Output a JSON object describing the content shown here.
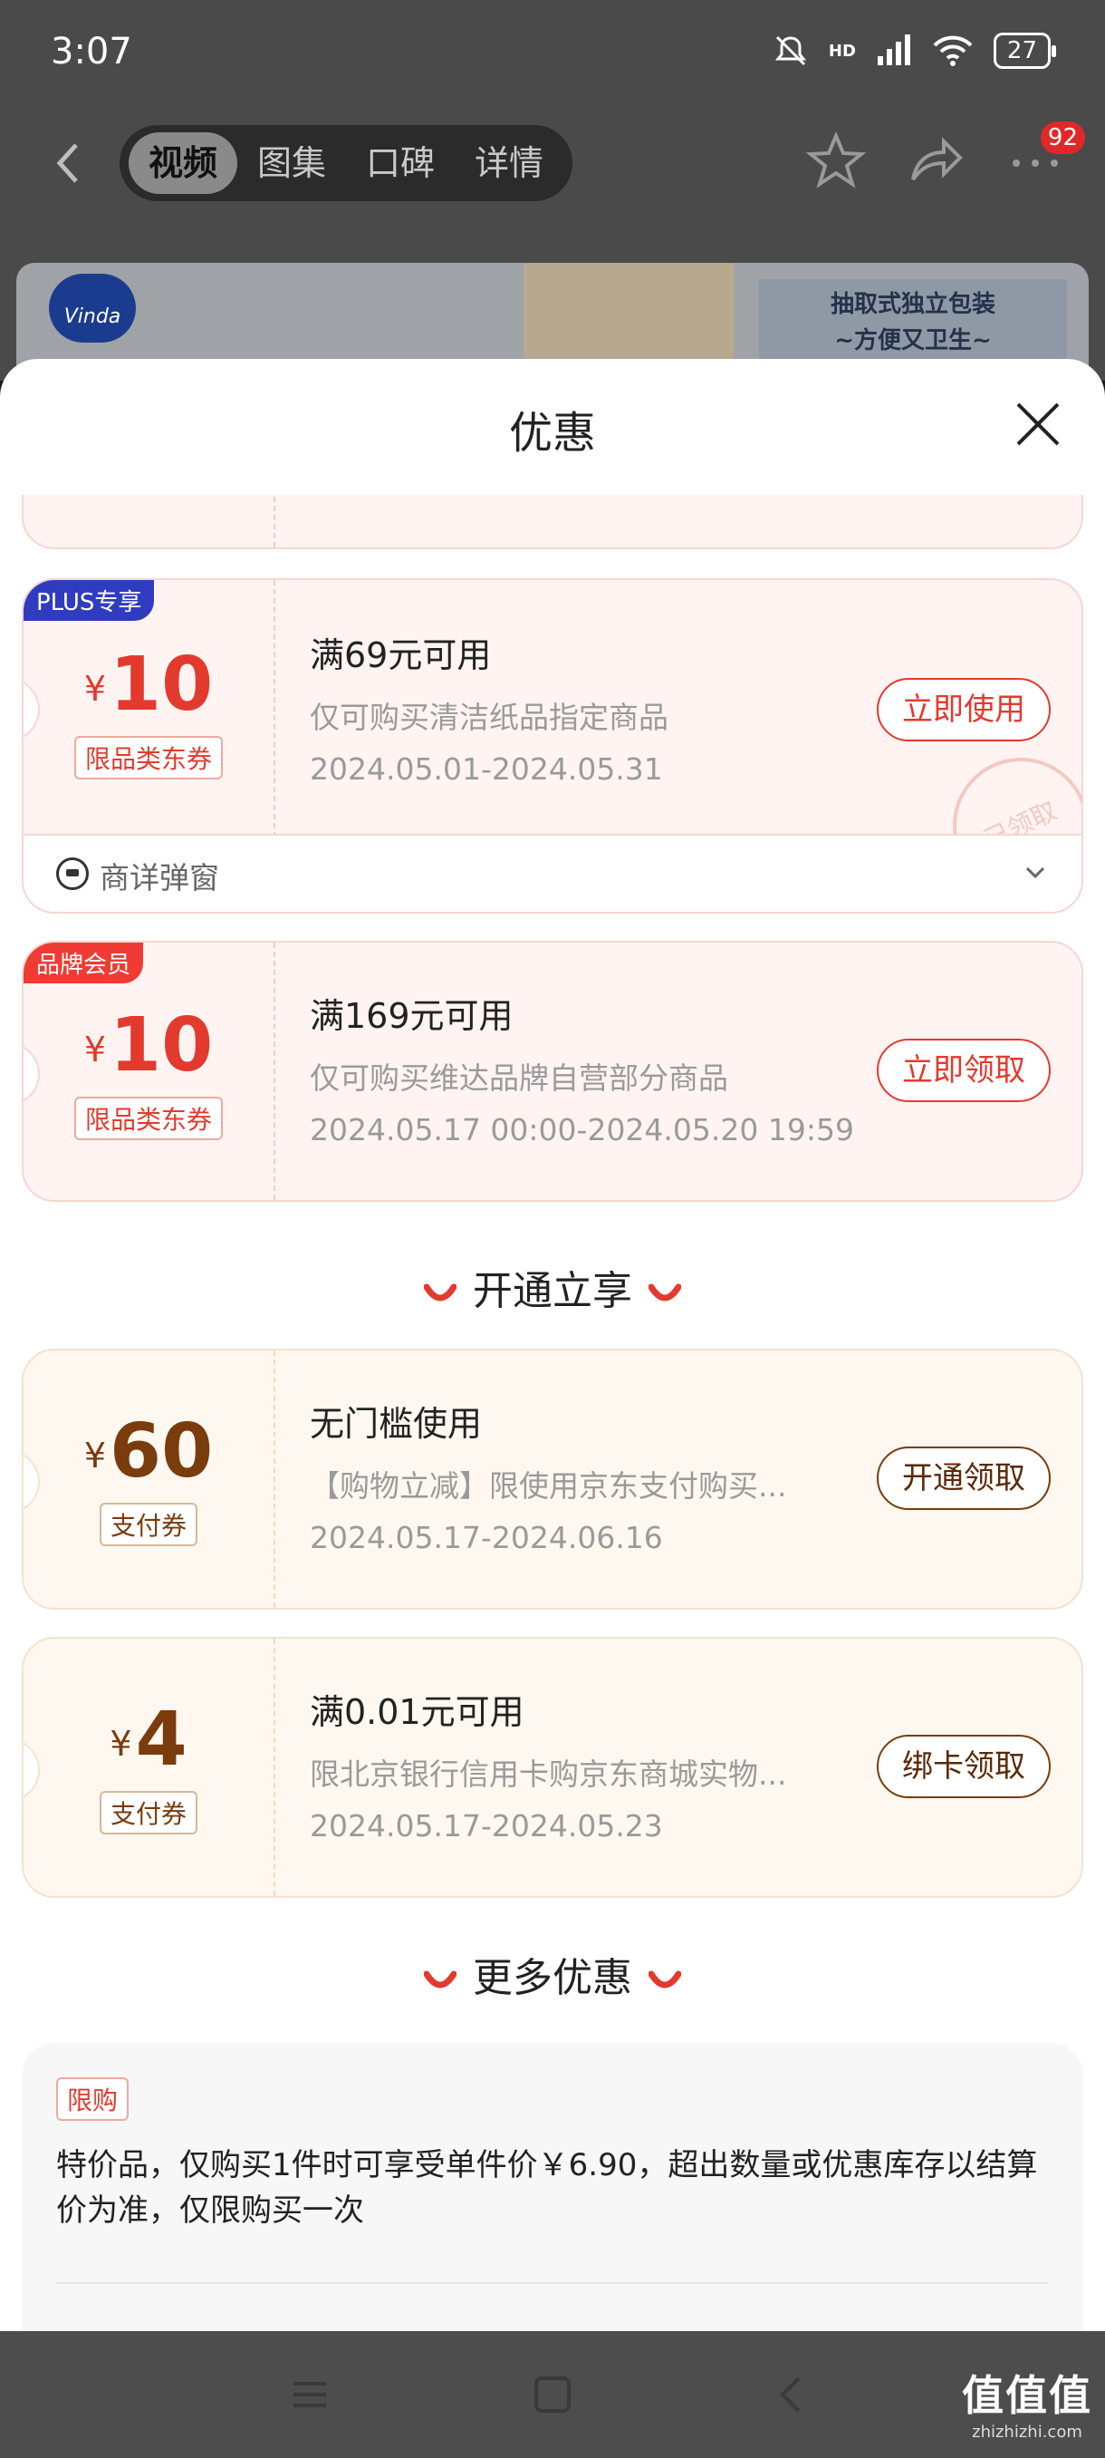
{
  "status_bar": {
    "time": "3:07",
    "network": "HD",
    "battery": "27"
  },
  "top_nav": {
    "tabs": [
      "视频",
      "图集",
      "口碑",
      "详情"
    ],
    "active_tab": 0,
    "badge_count": "92"
  },
  "banner": {
    "logo_text": "Vinda",
    "tagline_line1": "抽取式独立包装",
    "tagline_line2": "~方便又卫生~"
  },
  "sheet": {
    "title": "优惠"
  },
  "coupons": [
    {
      "tag": "PLUS专享",
      "amount_symbol": "¥",
      "amount": "10",
      "type": "限品类东券",
      "condition": "满69元可用",
      "description": "仅可购买清洁纸品指定商品",
      "date": "2024.05.01-2024.05.31",
      "button": "立即使用",
      "stamp": "已领取",
      "detail_label": "商详弹窗"
    },
    {
      "tag": "品牌会员",
      "amount_symbol": "¥",
      "amount": "10",
      "type": "限品类东券",
      "condition": "满169元可用",
      "description": "仅可购买维达品牌自营部分商品",
      "date": "2024.05.17 00:00-2024.05.20 19:59",
      "button": "立即领取"
    }
  ],
  "section_open": {
    "title": "开通立享"
  },
  "pay_coupons": [
    {
      "amount_symbol": "¥",
      "amount": "60",
      "type": "支付券",
      "condition": "无门槛使用",
      "description": "【购物立减】限使用京东支付购买...",
      "date": "2024.05.17-2024.06.16",
      "button": "开通领取"
    },
    {
      "amount_symbol": "¥",
      "amount": "4",
      "type": "支付券",
      "condition": "满0.01元可用",
      "description": "限北京银行信用卡购京东商城实物...",
      "date": "2024.05.17-2024.05.23",
      "button": "绑卡领取"
    }
  ],
  "section_more": {
    "title": "更多优惠"
  },
  "more": {
    "tag": "限购",
    "text": "特价品，仅购买1件时可享受单件价￥6.90，超出数量或优惠库存以结算价为准，仅限购买一次"
  },
  "watermark": {
    "big": "值值值",
    "small": "zhizhizhi.com"
  },
  "colors": {
    "accent_red": "#e33a2e",
    "plus_blue": "#2f3cc0",
    "brand_red": "#ef3b34",
    "gold_brown": "#7a3b0d"
  }
}
